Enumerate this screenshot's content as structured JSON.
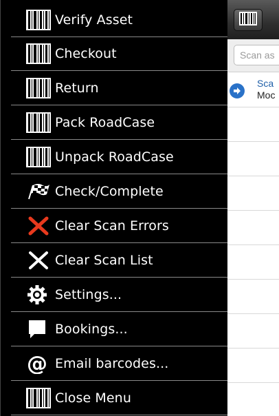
{
  "menu": {
    "items": [
      {
        "label": "Verify Asset",
        "icon": "barcode-icon"
      },
      {
        "label": "Checkout",
        "icon": "barcode-icon"
      },
      {
        "label": "Return",
        "icon": "barcode-icon"
      },
      {
        "label": "Pack RoadCase",
        "icon": "barcode-icon"
      },
      {
        "label": "Unpack RoadCase",
        "icon": "barcode-icon"
      },
      {
        "label": "Check/Complete",
        "icon": "checkered-flag-icon"
      },
      {
        "label": "Clear Scan Errors",
        "icon": "red-x-icon"
      },
      {
        "label": "Clear Scan List",
        "icon": "white-x-icon"
      },
      {
        "label": "Settings...",
        "icon": "gear-icon"
      },
      {
        "label": "Bookings...",
        "icon": "chat-bubble-icon"
      },
      {
        "label": "Email barcodes...",
        "icon": "at-sign-icon"
      },
      {
        "label": "Close Menu",
        "icon": "barcode-icon"
      }
    ]
  },
  "main": {
    "scan_button_icon": "barcode-icon",
    "search": {
      "placeholder": "Scan as"
    },
    "list": [
      {
        "title": "Sca",
        "subtitle": "Moc",
        "icon": "arrow-circle-icon"
      }
    ]
  },
  "colors": {
    "menu_bg": "#000000",
    "accent_blue": "#2a72c8",
    "error_red": "#e8391d"
  }
}
